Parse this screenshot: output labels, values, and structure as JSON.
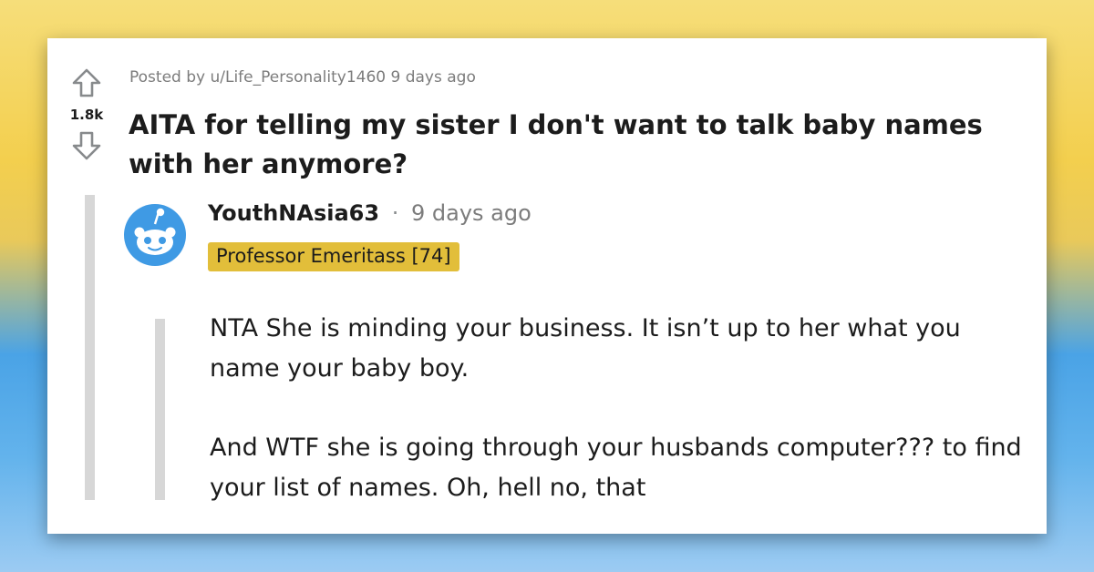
{
  "post": {
    "vote_count": "1.8k",
    "meta": "Posted by u/Life_Personality1460 9 days ago",
    "title": "AITA for telling my sister I don't want to talk baby names with her anymore?"
  },
  "comment": {
    "author": "YouthNAsia63",
    "separator": "·",
    "time": "9 days ago",
    "flair": "Professor Emeritass [74]",
    "paragraphs": [
      "NTA She is minding your business. It isn’t up to her what you name your baby boy.",
      "And WTF she is going through your husbands computer??? to find your list of names. Oh, hell no, that"
    ]
  },
  "colors": {
    "flair_bg": "#e2be3a",
    "avatar_bg": "#3f9ae4",
    "thread_line": "#d7d7d7",
    "meta_text": "#7c7c7c"
  },
  "icons": {
    "upvote": "upvote-arrow-icon",
    "downvote": "downvote-arrow-icon",
    "avatar": "reddit-snoo-avatar-icon"
  }
}
